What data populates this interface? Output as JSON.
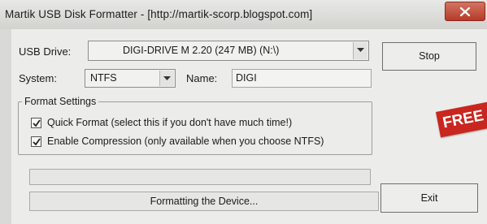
{
  "window": {
    "title": "Martik USB Disk Formatter - [http://martik-scorp.blogspot.com]"
  },
  "usb_drive": {
    "label": "USB Drive:",
    "selected": "DIGI-DRIVE M    2.20 (247 MB) (N:\\)"
  },
  "system": {
    "label": "System:",
    "selected": "NTFS"
  },
  "name": {
    "label": "Name:",
    "value": "DIGI"
  },
  "format_settings": {
    "title": "Format Settings",
    "options": [
      {
        "label": "Quick Format (select this if you don't have much time!)",
        "checked": true
      },
      {
        "label": "Enable Compression (only available when you choose NTFS)",
        "checked": true
      }
    ]
  },
  "buttons": {
    "stop": "Stop",
    "exit": "Exit"
  },
  "status": {
    "text": "Formatting the Device...",
    "progress": 0
  },
  "overlay": {
    "banner_text": "FREE",
    "banner_color": "#c9261f"
  }
}
